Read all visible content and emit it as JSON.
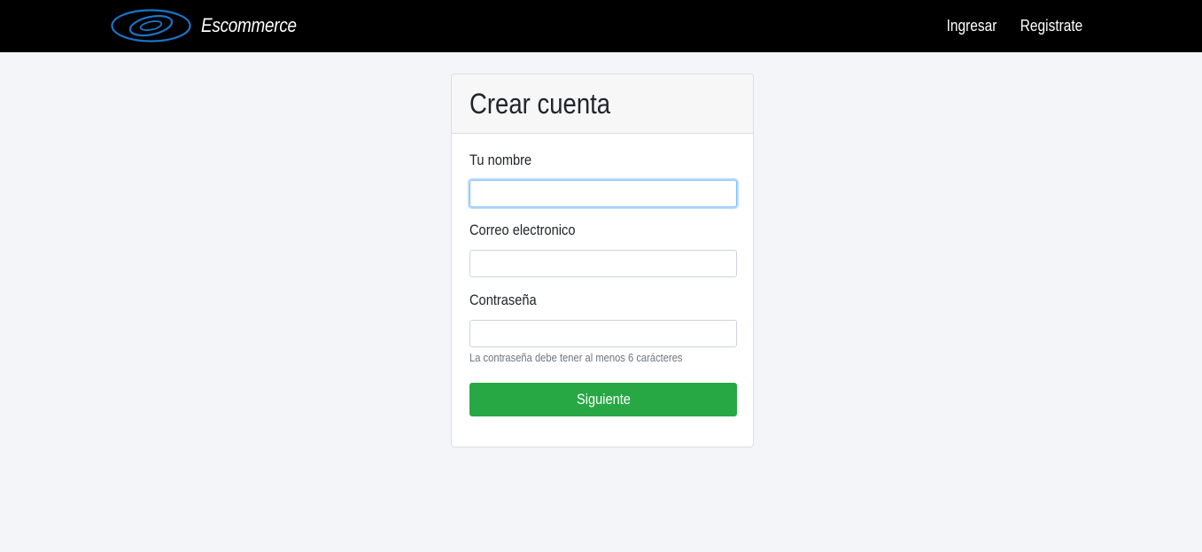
{
  "navbar": {
    "brand_name": "Escommerce",
    "logo_icon": "double-ellipse-logo-icon",
    "logo_color": "#1a73c8",
    "links": {
      "login": "Ingresar",
      "register": "Registrate"
    }
  },
  "form": {
    "title": "Crear cuenta",
    "name_label": "Tu nombre",
    "name_value": "",
    "email_label": "Correo electronico",
    "email_value": "",
    "password_label": "Contraseña",
    "password_value": "",
    "password_help": "La contraseña debe tener al menos 6 carácteres",
    "submit_label": "Siguiente"
  },
  "colors": {
    "navbar_bg": "#000000",
    "page_bg": "#f3f5f8",
    "submit_bg": "#28a745",
    "focus_border": "#80bdff"
  }
}
